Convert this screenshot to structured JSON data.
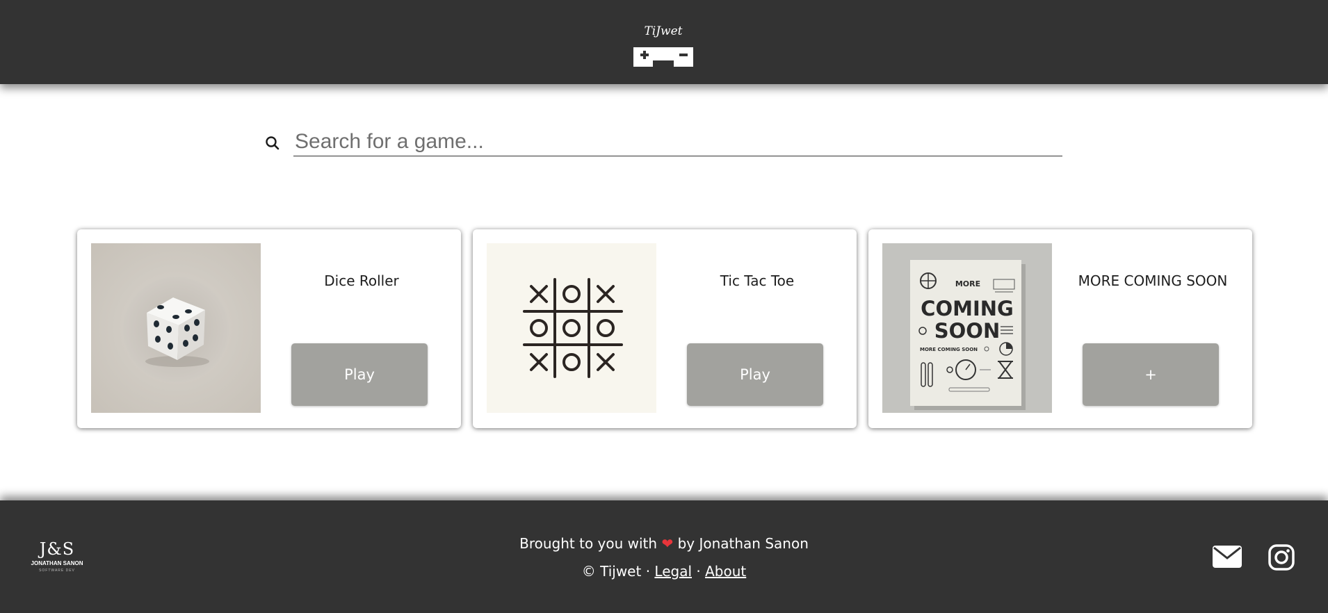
{
  "header": {
    "logo_text": "TiJwet",
    "logo_icon": "gamepad-icon"
  },
  "search": {
    "placeholder": "Search for a game...",
    "icon": "search-icon"
  },
  "cards": [
    {
      "title": "Dice Roller",
      "button_label": "Play",
      "image": "dice-image"
    },
    {
      "title": "Tic Tac Toe",
      "button_label": "Play",
      "image": "tic-tac-toe-image"
    },
    {
      "title": "MORE COMING SOON",
      "button_label": "+",
      "image": "coming-soon-poster-image",
      "poster_text": [
        "MORE",
        "COMING",
        "SOON",
        "MORE COMING SOON"
      ]
    }
  ],
  "footer": {
    "brand": {
      "monogram": "J&S",
      "name": "JONATHAN SANON",
      "sub": "SOFTWARE DEV"
    },
    "brought_prefix": "Brought to you with",
    "heart": "❤",
    "brought_suffix": "by Jonathan Sanon",
    "copyright": "© Tijwet",
    "separator": "·",
    "legal_label": "Legal",
    "about_label": "About",
    "icons": [
      "mail-icon",
      "instagram-icon"
    ]
  },
  "colors": {
    "bar": "#333333",
    "button": "#a2a29e",
    "heart": "#e8353b"
  }
}
